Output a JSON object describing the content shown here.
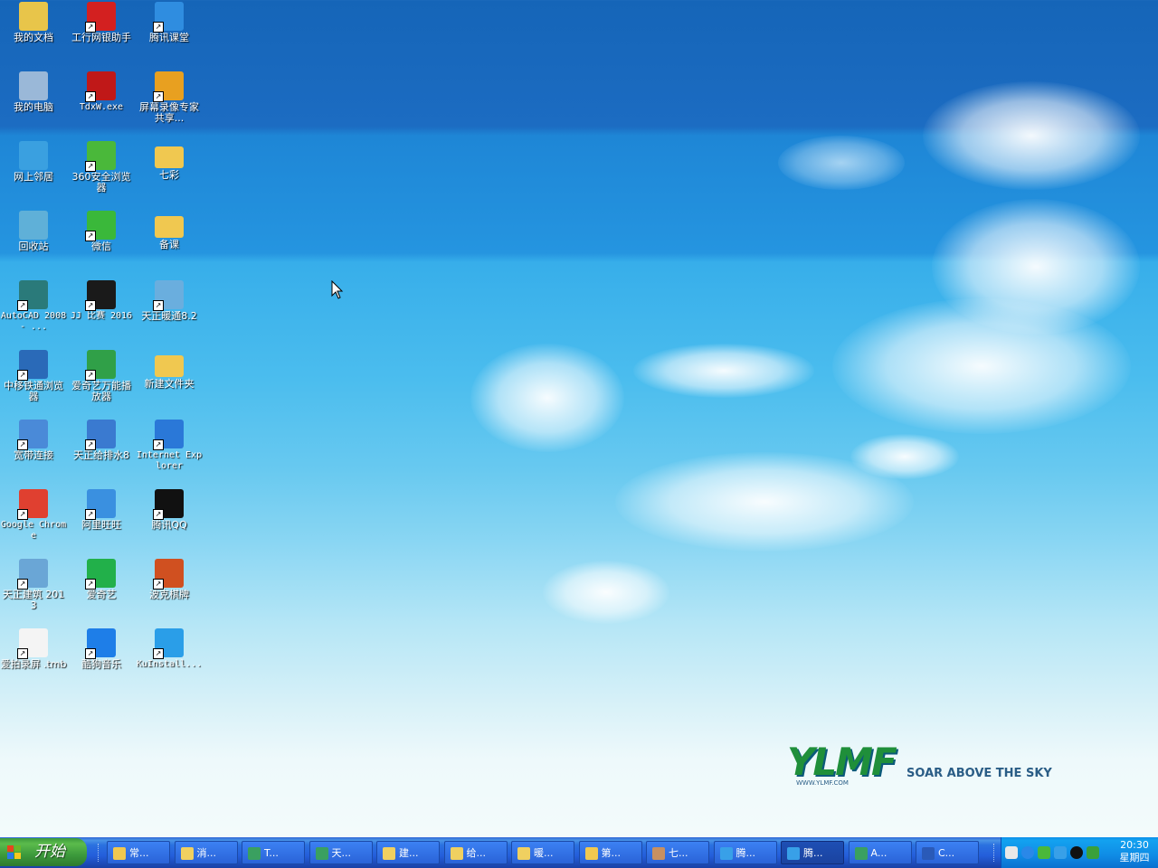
{
  "desktop": {
    "icons": [
      {
        "label": "我的文档",
        "kind": "documents"
      },
      {
        "label": "工行网银助手",
        "kind": "icbc"
      },
      {
        "label": "腾讯课堂",
        "kind": "tencent-class"
      },
      {
        "label": "我的电脑",
        "kind": "computer"
      },
      {
        "label": "TdxW.exe",
        "kind": "tdx"
      },
      {
        "label": "屏幕录像专家 共享...",
        "kind": "screen-recorder"
      },
      {
        "label": "网上邻居",
        "kind": "network"
      },
      {
        "label": "360安全浏览器",
        "kind": "browser-360"
      },
      {
        "label": "七彩",
        "kind": "folder"
      },
      {
        "label": "回收站",
        "kind": "recycle-bin"
      },
      {
        "label": "微信",
        "kind": "wechat"
      },
      {
        "label": "备课",
        "kind": "folder"
      },
      {
        "label": "AutoCAD 2008 - ...",
        "kind": "autocad"
      },
      {
        "label": "JJ 比赛 2016",
        "kind": "jj"
      },
      {
        "label": "天正暖通8.2",
        "kind": "tangent-hvac"
      },
      {
        "label": "中移铁通浏览器",
        "kind": "browser-cmtt"
      },
      {
        "label": "爱奇艺万能播放器",
        "kind": "iqiyi-player"
      },
      {
        "label": "新建文件夹",
        "kind": "folder"
      },
      {
        "label": "宽带连接",
        "kind": "broadband"
      },
      {
        "label": "天正给排水8",
        "kind": "tangent-water"
      },
      {
        "label": "Internet Explorer",
        "kind": "ie"
      },
      {
        "label": "Google Chrome",
        "kind": "chrome"
      },
      {
        "label": "阿里旺旺",
        "kind": "aliwangwang"
      },
      {
        "label": "腾讯QQ",
        "kind": "qq"
      },
      {
        "label": "天正建筑 2013",
        "kind": "tangent-arch"
      },
      {
        "label": "爱奇艺",
        "kind": "iqiyi"
      },
      {
        "label": "波克棋牌",
        "kind": "poker"
      },
      {
        "label": "爱拍录屏 .tmb",
        "kind": "file"
      },
      {
        "label": "酷狗音乐",
        "kind": "kugou"
      },
      {
        "label": "KuInstall...",
        "kind": "kuinstall"
      }
    ]
  },
  "logo": {
    "mark": "YLMF",
    "tagline": "SOAR ABOVE THE SKY",
    "url": "WWW.YLMF.COM"
  },
  "taskbar": {
    "start_label": "开始",
    "tasks": [
      {
        "label": "常...",
        "kind": "folder",
        "active": false
      },
      {
        "label": "消...",
        "kind": "help",
        "active": false
      },
      {
        "label": "T...",
        "kind": "app",
        "active": false
      },
      {
        "label": "天...",
        "kind": "app",
        "active": false
      },
      {
        "label": "建...",
        "kind": "help",
        "active": false
      },
      {
        "label": "给...",
        "kind": "help",
        "active": false
      },
      {
        "label": "暖...",
        "kind": "help",
        "active": false
      },
      {
        "label": "第...",
        "kind": "folder",
        "active": false
      },
      {
        "label": "七...",
        "kind": "photo",
        "active": false
      },
      {
        "label": "腾...",
        "kind": "tencent",
        "active": false
      },
      {
        "label": "腾...",
        "kind": "tencent",
        "active": true
      },
      {
        "label": "A...",
        "kind": "app",
        "active": false
      },
      {
        "label": "C...",
        "kind": "word",
        "active": false
      }
    ],
    "clock_time": "20:30",
    "clock_day": "星期四"
  },
  "colors": {
    "icon_colors": {
      "documents": "#e8c54a",
      "icbc": "#d32020",
      "tencent-class": "#2f8de0",
      "computer": "#9ab8d8",
      "tdx": "#c01818",
      "screen-recorder": "#e8a020",
      "network": "#3aa0e0",
      "browser-360": "#4ab83a",
      "folder": "#f0c850",
      "recycle-bin": "#5fb0d8",
      "wechat": "#3ab83a",
      "autocad": "#2a7a7a",
      "jj": "#1a1a1a",
      "tangent-hvac": "#6aaede",
      "browser-cmtt": "#2a6ab8",
      "iqiyi-player": "#30a048",
      "broadband": "#4a8ad8",
      "tangent-water": "#3a7ad0",
      "ie": "#2a78d8",
      "chrome": "#e04030",
      "aliwangwang": "#3a90e0",
      "qq": "#111111",
      "tangent-arch": "#6aa6d6",
      "iqiyi": "#22b04a",
      "poker": "#d05020",
      "file": "#f4f4f4",
      "kugou": "#1e7ee8",
      "kuinstall": "#2a9ee8"
    },
    "task_icons": {
      "folder": "#f0c850",
      "help": "#f0d060",
      "app": "#3aa060",
      "photo": "#c89060",
      "tencent": "#38a0e8",
      "word": "#2a5ab8"
    }
  }
}
